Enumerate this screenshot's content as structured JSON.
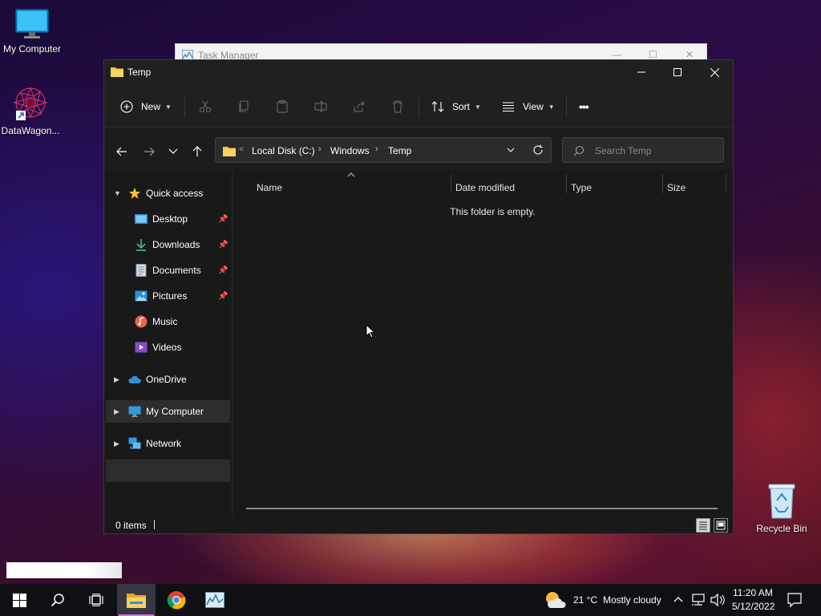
{
  "desktop": {
    "icons": [
      {
        "label": "My Computer",
        "icon": "monitor-icon"
      },
      {
        "label": "DataWagon...",
        "icon": "datawagon-shortcut-icon"
      },
      {
        "label": "Recycle Bin",
        "icon": "recycle-bin-icon"
      }
    ]
  },
  "background_window": {
    "title": "Task Manager"
  },
  "explorer": {
    "title": "Temp",
    "toolbar": {
      "new_label": "New",
      "sort_label": "Sort",
      "view_label": "View",
      "more_label": "•••"
    },
    "address": {
      "overflow": "«",
      "crumbs": [
        "Local Disk (C:)",
        "Windows",
        "Temp"
      ],
      "separator": "›"
    },
    "search": {
      "placeholder": "Search Temp"
    },
    "sidebar": {
      "quick_access": "Quick access",
      "pinned": [
        {
          "label": "Desktop",
          "icon": "desktop-folder-icon",
          "pinned": true
        },
        {
          "label": "Downloads",
          "icon": "downloads-folder-icon",
          "pinned": true
        },
        {
          "label": "Documents",
          "icon": "documents-folder-icon",
          "pinned": true
        },
        {
          "label": "Pictures",
          "icon": "pictures-folder-icon",
          "pinned": true
        },
        {
          "label": "Music",
          "icon": "music-folder-icon",
          "pinned": false
        },
        {
          "label": "Videos",
          "icon": "videos-folder-icon",
          "pinned": false
        }
      ],
      "onedrive": "OneDrive",
      "my_computer": "My Computer",
      "network": "Network"
    },
    "columns": [
      "Name",
      "Date modified",
      "Type",
      "Size"
    ],
    "empty_message": "This folder is empty.",
    "status": {
      "items": "0 items"
    }
  },
  "taskbar": {
    "apps": [
      "start-icon",
      "search-icon",
      "task-view-icon",
      "file-explorer-icon",
      "chrome-icon",
      "task-manager-icon"
    ],
    "weather": {
      "temp": "21 °C",
      "condition": "Mostly cloudy"
    },
    "clock": {
      "time": "11:20 AM",
      "date": "5/12/2022"
    }
  },
  "colors": {
    "accent": "#d07ad0",
    "folder": "#f4c54a",
    "window_bg": "#191919"
  }
}
